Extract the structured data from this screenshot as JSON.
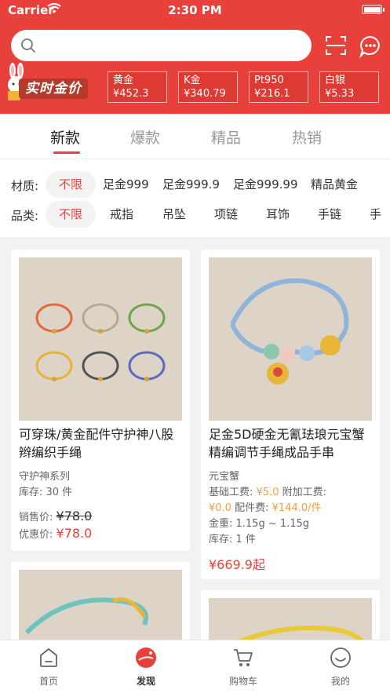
{
  "status_bar": {
    "carrier": "Carrier",
    "time": "2:30 PM"
  },
  "search": {
    "placeholder": ""
  },
  "gold_banner": {
    "label": "实时金价"
  },
  "prices": [
    {
      "name": "黄金",
      "value": "¥452.3"
    },
    {
      "name": "K金",
      "value": "¥340.79"
    },
    {
      "name": "Pt950",
      "value": "¥216.1"
    },
    {
      "name": "白银",
      "value": "¥5.33"
    }
  ],
  "tabs": [
    {
      "label": "新款"
    },
    {
      "label": "爆款"
    },
    {
      "label": "精品"
    },
    {
      "label": "热销"
    }
  ],
  "filters": {
    "material": {
      "label": "材质:",
      "options": [
        "不限",
        "足金999",
        "足金999.9",
        "足金999.99",
        "精品黄金"
      ]
    },
    "category": {
      "label": "品类:",
      "options": [
        "不限",
        "戒指",
        "吊坠",
        "项链",
        "耳饰",
        "手链",
        "手"
      ]
    }
  },
  "products": [
    {
      "title": "可穿珠/黄金配件守护神八股辫编织手绳",
      "series": "守护神系列",
      "stock": "库存: 30 件",
      "sale_label": "销售价:",
      "sale_price": "¥78.0",
      "promo_label": "优惠价:",
      "promo_price": "¥78.0"
    },
    {
      "title": "足金5D硬金无氰珐琅元宝蟹精编调节手绳成品手串",
      "series": "元宝蟹",
      "base_fee_label": "基础工费:",
      "base_fee": "¥5.0",
      "extra_fee_label": "附加工费:",
      "extra_fee": "¥0.0",
      "parts_fee_label": "配件费:",
      "parts_fee": "¥144.0/件",
      "weight": "金重: 1.15g ~ 1.15g",
      "stock": "库存: 1 件",
      "price": "¥669.9起"
    }
  ],
  "bottom_nav": [
    {
      "label": "首页"
    },
    {
      "label": "发现"
    },
    {
      "label": "购物车"
    },
    {
      "label": "我的"
    }
  ],
  "colors": {
    "brand_red": "#e8403a",
    "accent_orange": "#f0a03a"
  }
}
